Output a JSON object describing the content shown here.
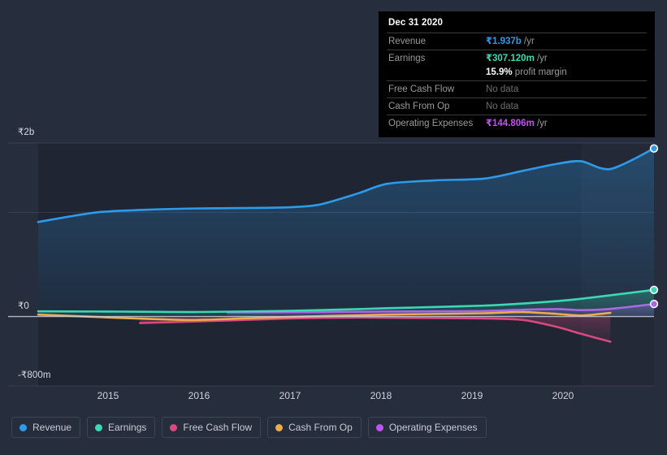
{
  "theme": {
    "background": "#262d3d",
    "plot_background": "#1f2533",
    "grid_color": "#3b4354",
    "axis_text": "#cdd2da"
  },
  "chart_data": {
    "type": "area",
    "title": "",
    "xlabel": "",
    "ylabel": "",
    "grid": true,
    "legend_position": "bottom-left",
    "currency_symbol": "₹",
    "x_tick_labels": [
      "2015",
      "2016",
      "2017",
      "2018",
      "2019",
      "2020"
    ],
    "y_tick_labels": [
      "₹2b",
      "₹0",
      "-₹800m"
    ],
    "ylim": [
      -800000000,
      2000000000
    ],
    "y_gridlines": [
      2000000000,
      1200000000,
      0,
      -800000000
    ],
    "x": [
      2014.4,
      2015,
      2015.5,
      2016,
      2016.5,
      2017,
      2017.3,
      2017.7,
      2018,
      2018.5,
      2019,
      2019.4,
      2019.75,
      2020,
      2020.3,
      2020.75
    ],
    "series": [
      {
        "name": "Revenue",
        "color": "#2e9bea",
        "fill": true,
        "values": [
          1090000000,
          1200000000,
          1230000000,
          1245000000,
          1250000000,
          1260000000,
          1290000000,
          1420000000,
          1530000000,
          1570000000,
          1590000000,
          1680000000,
          1760000000,
          1790000000,
          1700000000,
          1937000000
        ],
        "end_marker": true
      },
      {
        "name": "Earnings",
        "color": "#3ad8b4",
        "fill": true,
        "values": [
          60000000,
          58000000,
          55000000,
          52000000,
          58000000,
          66000000,
          74000000,
          86000000,
          96000000,
          110000000,
          126000000,
          150000000,
          178000000,
          205000000,
          245000000,
          307120000
        ],
        "end_marker": true
      },
      {
        "name": "Free Cash Flow",
        "color": "#d9487e",
        "fill": true,
        "start_x": 2015.45,
        "values": [
          null,
          null,
          -75000000,
          -58000000,
          -40000000,
          -22000000,
          -16000000,
          -12000000,
          -14000000,
          -18000000,
          -22000000,
          -40000000,
          -120000000,
          -200000000,
          -290000000,
          -400000000
        ],
        "end_marker": false,
        "no_data_latest": true
      },
      {
        "name": "Cash From Op",
        "color": "#eeab4c",
        "fill": false,
        "values": [
          22000000,
          -5000000,
          -26000000,
          -40000000,
          -22000000,
          -5000000,
          4000000,
          14000000,
          22000000,
          30000000,
          38000000,
          52000000,
          30000000,
          12000000,
          42000000,
          66000000
        ],
        "end_marker": false,
        "no_data_latest": true
      },
      {
        "name": "Operating Expenses",
        "color": "#c052f0",
        "fill": true,
        "start_x": 2016.35,
        "values": [
          null,
          null,
          null,
          null,
          48000000,
          50000000,
          52000000,
          55000000,
          57000000,
          60000000,
          64000000,
          78000000,
          86000000,
          74000000,
          88000000,
          144806000
        ],
        "end_marker": true
      }
    ]
  },
  "tooltip": {
    "date": "Dec 31 2020",
    "rows": [
      {
        "key": "Revenue",
        "amount": "₹1.937b",
        "unit": "/yr",
        "color": "rev"
      },
      {
        "key": "Earnings",
        "amount": "₹307.120m",
        "unit": "/yr",
        "color": "earn"
      },
      {
        "key": "",
        "amount": "15.9%",
        "unit": "profit margin",
        "color": "white",
        "sub": true
      },
      {
        "key": "Free Cash Flow",
        "amount": "",
        "unit": "",
        "nodata": "No data"
      },
      {
        "key": "Cash From Op",
        "amount": "",
        "unit": "",
        "nodata": "No data"
      },
      {
        "key": "Operating Expenses",
        "amount": "₹144.806m",
        "unit": "/yr",
        "color": "opex"
      }
    ]
  },
  "legend": {
    "items": [
      {
        "label": "Revenue",
        "color": "#2e9bea"
      },
      {
        "label": "Earnings",
        "color": "#3ad8b4"
      },
      {
        "label": "Free Cash Flow",
        "color": "#d9487e"
      },
      {
        "label": "Cash From Op",
        "color": "#eeab4c"
      },
      {
        "label": "Operating Expenses",
        "color": "#c052f0"
      }
    ]
  }
}
